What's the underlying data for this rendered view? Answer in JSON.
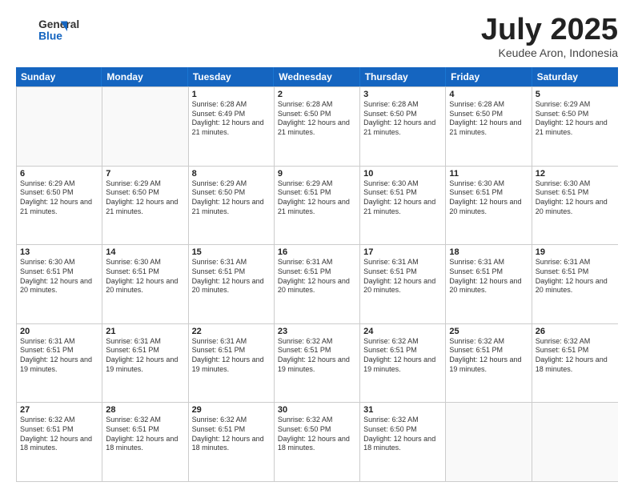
{
  "logo": {
    "general": "General",
    "blue": "Blue"
  },
  "title": {
    "month_year": "July 2025",
    "location": "Keudee Aron, Indonesia"
  },
  "days_of_week": [
    "Sunday",
    "Monday",
    "Tuesday",
    "Wednesday",
    "Thursday",
    "Friday",
    "Saturday"
  ],
  "weeks": [
    [
      {
        "day": "",
        "info": "",
        "empty": true
      },
      {
        "day": "",
        "info": "",
        "empty": true
      },
      {
        "day": "1",
        "info": "Sunrise: 6:28 AM\nSunset: 6:49 PM\nDaylight: 12 hours and 21 minutes."
      },
      {
        "day": "2",
        "info": "Sunrise: 6:28 AM\nSunset: 6:50 PM\nDaylight: 12 hours and 21 minutes."
      },
      {
        "day": "3",
        "info": "Sunrise: 6:28 AM\nSunset: 6:50 PM\nDaylight: 12 hours and 21 minutes."
      },
      {
        "day": "4",
        "info": "Sunrise: 6:28 AM\nSunset: 6:50 PM\nDaylight: 12 hours and 21 minutes."
      },
      {
        "day": "5",
        "info": "Sunrise: 6:29 AM\nSunset: 6:50 PM\nDaylight: 12 hours and 21 minutes."
      }
    ],
    [
      {
        "day": "6",
        "info": "Sunrise: 6:29 AM\nSunset: 6:50 PM\nDaylight: 12 hours and 21 minutes."
      },
      {
        "day": "7",
        "info": "Sunrise: 6:29 AM\nSunset: 6:50 PM\nDaylight: 12 hours and 21 minutes."
      },
      {
        "day": "8",
        "info": "Sunrise: 6:29 AM\nSunset: 6:50 PM\nDaylight: 12 hours and 21 minutes."
      },
      {
        "day": "9",
        "info": "Sunrise: 6:29 AM\nSunset: 6:51 PM\nDaylight: 12 hours and 21 minutes."
      },
      {
        "day": "10",
        "info": "Sunrise: 6:30 AM\nSunset: 6:51 PM\nDaylight: 12 hours and 21 minutes."
      },
      {
        "day": "11",
        "info": "Sunrise: 6:30 AM\nSunset: 6:51 PM\nDaylight: 12 hours and 20 minutes."
      },
      {
        "day": "12",
        "info": "Sunrise: 6:30 AM\nSunset: 6:51 PM\nDaylight: 12 hours and 20 minutes."
      }
    ],
    [
      {
        "day": "13",
        "info": "Sunrise: 6:30 AM\nSunset: 6:51 PM\nDaylight: 12 hours and 20 minutes."
      },
      {
        "day": "14",
        "info": "Sunrise: 6:30 AM\nSunset: 6:51 PM\nDaylight: 12 hours and 20 minutes."
      },
      {
        "day": "15",
        "info": "Sunrise: 6:31 AM\nSunset: 6:51 PM\nDaylight: 12 hours and 20 minutes."
      },
      {
        "day": "16",
        "info": "Sunrise: 6:31 AM\nSunset: 6:51 PM\nDaylight: 12 hours and 20 minutes."
      },
      {
        "day": "17",
        "info": "Sunrise: 6:31 AM\nSunset: 6:51 PM\nDaylight: 12 hours and 20 minutes."
      },
      {
        "day": "18",
        "info": "Sunrise: 6:31 AM\nSunset: 6:51 PM\nDaylight: 12 hours and 20 minutes."
      },
      {
        "day": "19",
        "info": "Sunrise: 6:31 AM\nSunset: 6:51 PM\nDaylight: 12 hours and 20 minutes."
      }
    ],
    [
      {
        "day": "20",
        "info": "Sunrise: 6:31 AM\nSunset: 6:51 PM\nDaylight: 12 hours and 19 minutes."
      },
      {
        "day": "21",
        "info": "Sunrise: 6:31 AM\nSunset: 6:51 PM\nDaylight: 12 hours and 19 minutes."
      },
      {
        "day": "22",
        "info": "Sunrise: 6:31 AM\nSunset: 6:51 PM\nDaylight: 12 hours and 19 minutes."
      },
      {
        "day": "23",
        "info": "Sunrise: 6:32 AM\nSunset: 6:51 PM\nDaylight: 12 hours and 19 minutes."
      },
      {
        "day": "24",
        "info": "Sunrise: 6:32 AM\nSunset: 6:51 PM\nDaylight: 12 hours and 19 minutes."
      },
      {
        "day": "25",
        "info": "Sunrise: 6:32 AM\nSunset: 6:51 PM\nDaylight: 12 hours and 19 minutes."
      },
      {
        "day": "26",
        "info": "Sunrise: 6:32 AM\nSunset: 6:51 PM\nDaylight: 12 hours and 18 minutes."
      }
    ],
    [
      {
        "day": "27",
        "info": "Sunrise: 6:32 AM\nSunset: 6:51 PM\nDaylight: 12 hours and 18 minutes."
      },
      {
        "day": "28",
        "info": "Sunrise: 6:32 AM\nSunset: 6:51 PM\nDaylight: 12 hours and 18 minutes."
      },
      {
        "day": "29",
        "info": "Sunrise: 6:32 AM\nSunset: 6:51 PM\nDaylight: 12 hours and 18 minutes."
      },
      {
        "day": "30",
        "info": "Sunrise: 6:32 AM\nSunset: 6:50 PM\nDaylight: 12 hours and 18 minutes."
      },
      {
        "day": "31",
        "info": "Sunrise: 6:32 AM\nSunset: 6:50 PM\nDaylight: 12 hours and 18 minutes."
      },
      {
        "day": "",
        "info": "",
        "empty": true
      },
      {
        "day": "",
        "info": "",
        "empty": true
      }
    ]
  ]
}
